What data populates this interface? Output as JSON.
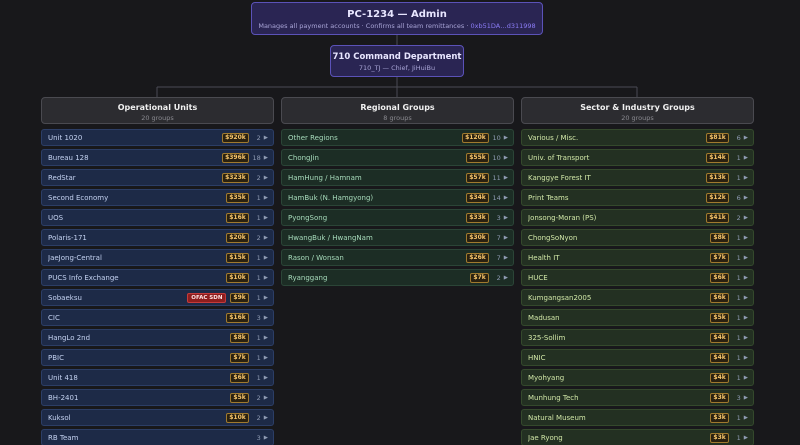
{
  "root": {
    "title": "PC-1234 — Admin",
    "subtitle": "Manages all payment accounts · Confirms all team remittances ·",
    "address": "0xb51DA…d311998"
  },
  "department": {
    "title": "710 Command Department",
    "subtitle": "710_TJ — Chief, JiHuiBu"
  },
  "columns": [
    {
      "title": "Operational Units",
      "subtitle": "20 groups",
      "items": [
        {
          "label": "Unit 1020",
          "amount": "$920k",
          "count": "2",
          "arrow": "▶"
        },
        {
          "label": "Bureau 128",
          "amount": "$396k",
          "count": "18",
          "arrow": "▶"
        },
        {
          "label": "RedStar",
          "amount": "$323k",
          "count": "2",
          "arrow": "▶"
        },
        {
          "label": "Second Economy",
          "amount": "$35k",
          "count": "1",
          "arrow": "▶"
        },
        {
          "label": "UOS",
          "amount": "$16k",
          "count": "1",
          "arrow": "▶"
        },
        {
          "label": "Polaris-171",
          "amount": "$20k",
          "count": "2",
          "arrow": "▶"
        },
        {
          "label": "JaeJong-Central",
          "amount": "$15k",
          "count": "1",
          "arrow": "▶"
        },
        {
          "label": "PUCS Info Exchange",
          "amount": "$10k",
          "count": "1",
          "arrow": "▶"
        },
        {
          "label": "Sobaeksu",
          "tag": "OFAC SDN",
          "amount": "$9k",
          "count": "1",
          "arrow": "▶"
        },
        {
          "label": "CIC",
          "amount": "$16k",
          "count": "3",
          "arrow": "▶"
        },
        {
          "label": "HangLo 2nd",
          "amount": "$8k",
          "count": "1",
          "arrow": "▶"
        },
        {
          "label": "PBIC",
          "amount": "$7k",
          "count": "1",
          "arrow": "▶"
        },
        {
          "label": "Unit 418",
          "amount": "$6k",
          "count": "1",
          "arrow": "▶"
        },
        {
          "label": "BH-2401",
          "amount": "$5k",
          "count": "2",
          "arrow": "▶"
        },
        {
          "label": "Kuksol",
          "amount": "$10k",
          "count": "2",
          "arrow": "▶"
        },
        {
          "label": "RB Team",
          "amount": "",
          "count": "3",
          "arrow": "▶"
        }
      ]
    },
    {
      "title": "Regional Groups",
      "subtitle": "8 groups",
      "items": [
        {
          "label": "Other Regions",
          "amount": "$120k",
          "count": "10",
          "arrow": "▶"
        },
        {
          "label": "ChongJin",
          "amount": "$55k",
          "count": "10",
          "arrow": "▶"
        },
        {
          "label": "HamHung / Hamnam",
          "amount": "$57k",
          "count": "11",
          "arrow": "▶"
        },
        {
          "label": "HamBuk (N. Hamgyong)",
          "amount": "$34k",
          "count": "14",
          "arrow": "▶"
        },
        {
          "label": "PyongSong",
          "amount": "$33k",
          "count": "3",
          "arrow": "▶"
        },
        {
          "label": "HwangBuk / HwangNam",
          "amount": "$30k",
          "count": "7",
          "arrow": "▶"
        },
        {
          "label": "Rason / Wonsan",
          "amount": "$26k",
          "count": "7",
          "arrow": "▶"
        },
        {
          "label": "Ryanggang",
          "amount": "$7k",
          "count": "2",
          "arrow": "▶"
        }
      ]
    },
    {
      "title": "Sector & Industry Groups",
      "subtitle": "20 groups",
      "items": [
        {
          "label": "Various / Misc.",
          "amount": "$81k",
          "count": "6",
          "arrow": "▶"
        },
        {
          "label": "Univ. of Transport",
          "amount": "$14k",
          "count": "1",
          "arrow": "▶"
        },
        {
          "label": "Kanggye Forest IT",
          "amount": "$13k",
          "count": "1",
          "arrow": "▶"
        },
        {
          "label": "Print Teams",
          "amount": "$12k",
          "count": "6",
          "arrow": "▶"
        },
        {
          "label": "Jonsong-Moran (PS)",
          "amount": "$41k",
          "count": "2",
          "arrow": "▶"
        },
        {
          "label": "ChongSoNyon",
          "amount": "$8k",
          "count": "1",
          "arrow": "▶"
        },
        {
          "label": "Health IT",
          "amount": "$7k",
          "count": "1",
          "arrow": "▶"
        },
        {
          "label": "HUCE",
          "amount": "$6k",
          "count": "1",
          "arrow": "▶"
        },
        {
          "label": "Kumgangsan2005",
          "amount": "$6k",
          "count": "1",
          "arrow": "▶"
        },
        {
          "label": "Madusan",
          "amount": "$5k",
          "count": "1",
          "arrow": "▶"
        },
        {
          "label": "325-Sollim",
          "amount": "$4k",
          "count": "1",
          "arrow": "▶"
        },
        {
          "label": "HNIC",
          "amount": "$4k",
          "count": "1",
          "arrow": "▶"
        },
        {
          "label": "Myohyang",
          "amount": "$4k",
          "count": "1",
          "arrow": "▶"
        },
        {
          "label": "Munhung Tech",
          "amount": "$3k",
          "count": "3",
          "arrow": "▶"
        },
        {
          "label": "Natural Museum",
          "amount": "$3k",
          "count": "1",
          "arrow": "▶"
        },
        {
          "label": "Jae Ryong",
          "amount": "$3k",
          "count": "1",
          "arrow": "▶"
        }
      ]
    }
  ]
}
